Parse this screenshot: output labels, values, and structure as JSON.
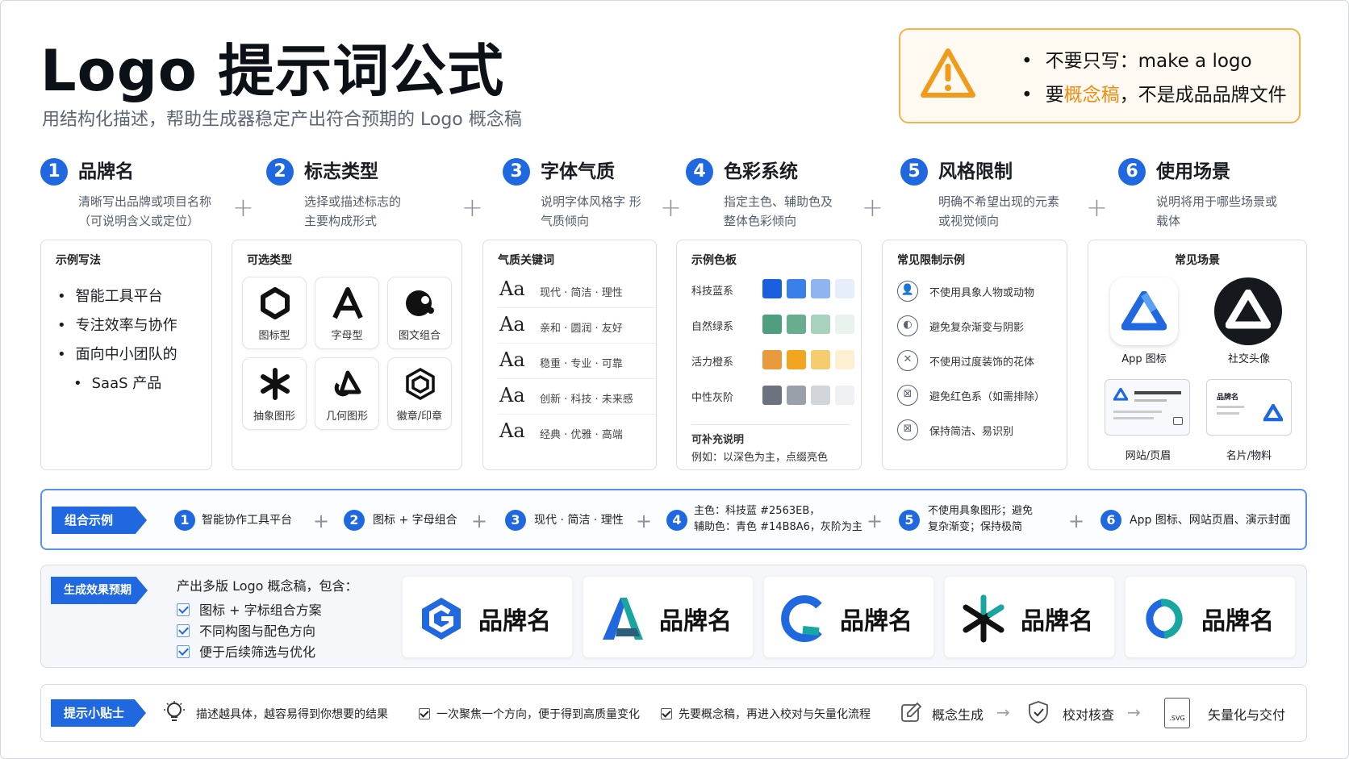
{
  "header": {
    "title": "Logo 提示词公式",
    "subtitle": "用结构化描述，帮助生成器稳定产出符合预期的 Logo 概念稿"
  },
  "warning": {
    "line1": "不要只写：make a logo",
    "line2_pre": "要",
    "line2_hl": "概念稿",
    "line2_post": "，不是成品品牌文件",
    "accent": "#f6b14c"
  },
  "steps": [
    {
      "num": "1",
      "title": "品牌名",
      "desc1": "清晰写出品牌或项目名称",
      "desc2": "（可说明含义或定位）"
    },
    {
      "num": "2",
      "title": "标志类型",
      "desc1": "选择或描述标志的",
      "desc2": "主要构成形式"
    },
    {
      "num": "3",
      "title": "字体气质",
      "desc1": "说明字体风格字 形",
      "desc2": "气质倾向"
    },
    {
      "num": "4",
      "title": "色彩系统",
      "desc1": "指定主色、辅助色及",
      "desc2": "整体色彩倾向"
    },
    {
      "num": "5",
      "title": "风格限制",
      "desc1": "明确不希望出现的元素",
      "desc2": "或视觉倾向"
    },
    {
      "num": "6",
      "title": "使用场景",
      "desc1": "说明将用于哪些场景或",
      "desc2": "载体"
    }
  ],
  "plus": "+",
  "card1": {
    "title": "示例写法",
    "items": [
      "智能工具平台",
      "专注效率与协作",
      "面向中小团队的",
      "SaaS 产品"
    ]
  },
  "card2": {
    "title": "可选类型",
    "types": [
      "图标型",
      "字母型",
      "图文组合",
      "抽象图形",
      "几何图形",
      "徽章/印章"
    ]
  },
  "card3": {
    "title": "气质关键词",
    "aa": "Aa",
    "rows": [
      "现代 · 简洁 · 理性",
      "亲和 · 圆润 · 友好",
      "稳重 · 专业 · 可靠",
      "创新 · 科技 · 未来感",
      "经典 · 优雅 · 高端"
    ]
  },
  "card4": {
    "title": "示例色板",
    "palettes": [
      {
        "label": "科技蓝系",
        "colors": [
          "#1a5fe0",
          "#3b7fe8",
          "#8fb5f0",
          "#e6eefb"
        ]
      },
      {
        "label": "自然绿系",
        "colors": [
          "#4f9e7f",
          "#68ad8e",
          "#a8d2bd",
          "#e8f3ed"
        ]
      },
      {
        "label": "活力橙系",
        "colors": [
          "#e89a3c",
          "#f2a620",
          "#f6cd6e",
          "#fcefd2"
        ]
      },
      {
        "label": "中性灰阶",
        "colors": [
          "#6b7280",
          "#9aa0aa",
          "#d2d5da",
          "#f0f1f3"
        ]
      }
    ],
    "note_title": "可补充说明",
    "note": "例如：以深色为主，点缀亮色"
  },
  "card5": {
    "title": "常见限制示例",
    "rules": [
      "不使用具象人物或动物",
      "避免复杂渐变与阴影",
      "不使用过度装饰的花体",
      "避免红色系（如需排除）",
      "保持简洁、易识别"
    ]
  },
  "card6": {
    "title": "常见场景",
    "scenes": [
      "App 图标",
      "社交头像",
      "网站/页眉",
      "名片/物料"
    ],
    "card_label": "品牌名"
  },
  "combo": {
    "tag": "组合示例",
    "items": [
      {
        "num": "1",
        "text": "智能协作工具平台"
      },
      {
        "num": "2",
        "text": "图标 + 字母组合"
      },
      {
        "num": "3",
        "text": "现代 · 简洁 · 理性"
      },
      {
        "num": "4",
        "text1": "主色：科技蓝 #2563EB，",
        "text2": "辅助色：青色 #14B8A6，灰阶为主"
      },
      {
        "num": "5",
        "text1": "不使用具象图形；避免",
        "text2": "复杂渐变；保持极简"
      },
      {
        "num": "6",
        "text": "App 图标、网站页眉、演示封面"
      }
    ]
  },
  "generate": {
    "tag": "生成效果预期",
    "intro": "产出多版 Logo 概念稿，包含：",
    "checks": [
      "图标 + 字标组合方案",
      "不同构图与配色方向",
      "便于后续筛选与优化"
    ],
    "brand": "品牌名"
  },
  "tips": {
    "tag": "提示小贴士",
    "tip1": "描述越具体，越容易得到你想要的结果",
    "tip2": "一次聚焦一个方向，便于得到高质量变化",
    "tip3": "先要概念稿，再进入校对与矢量化流程",
    "flow": [
      "概念生成",
      "校对核查",
      "矢量化与交付"
    ],
    "svg_label": ".SVG"
  },
  "colors": {
    "primary": "#1f68e0",
    "warning": "#f6b14c",
    "orange_text": "#f08a10"
  }
}
